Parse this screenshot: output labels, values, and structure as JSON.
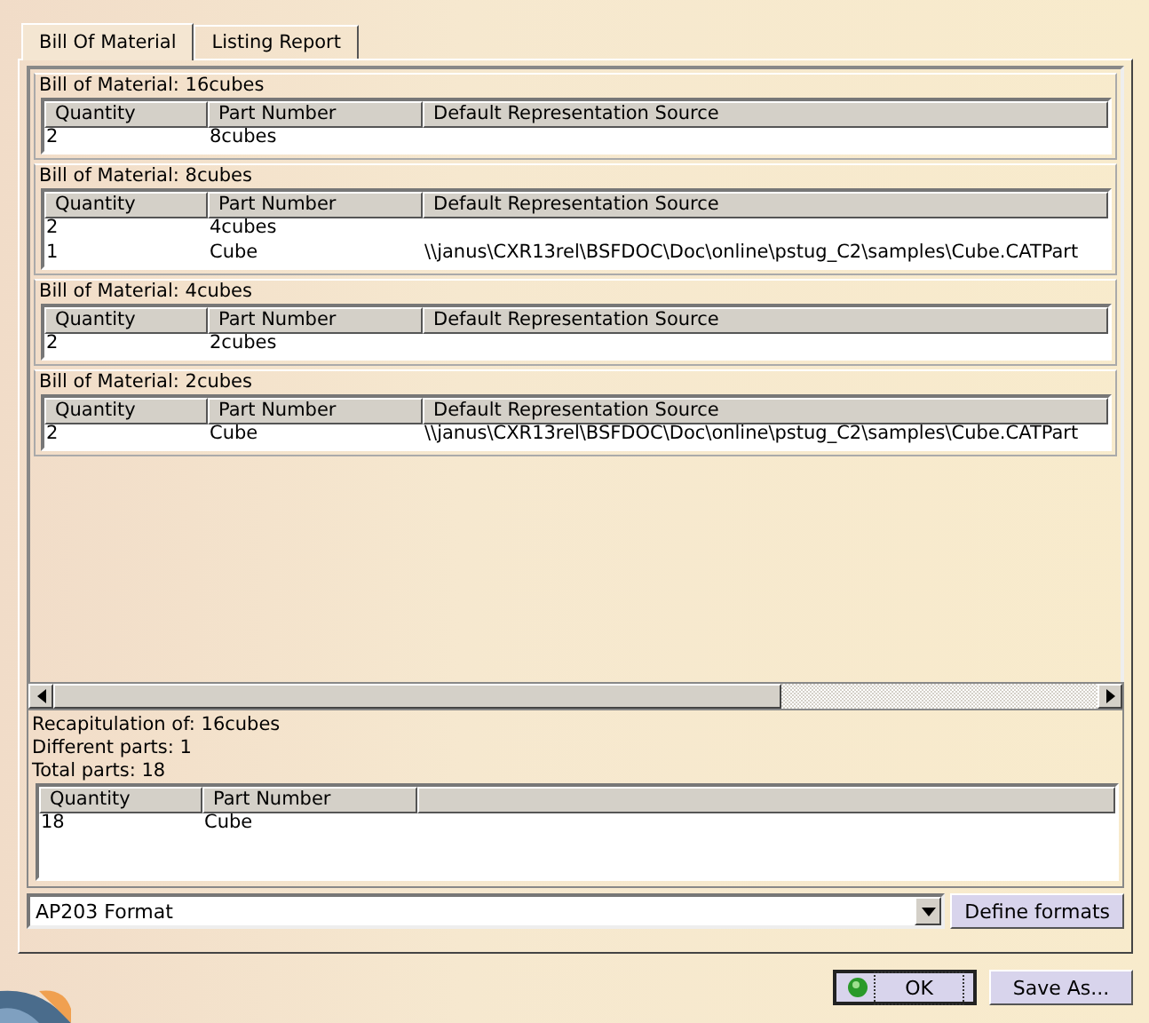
{
  "tabs": [
    {
      "label": "Bill Of Material",
      "selected": true
    },
    {
      "label": "Listing Report",
      "selected": false
    }
  ],
  "bom_sections": [
    {
      "title": "Bill of Material: 16cubes",
      "columns": [
        "Quantity",
        "Part Number",
        "Default Representation Source"
      ],
      "rows": [
        {
          "quantity": "2",
          "part_number": "8cubes"
        }
      ]
    },
    {
      "title": "Bill of Material: 8cubes",
      "columns": [
        "Quantity",
        "Part Number",
        "Default Representation Source"
      ],
      "rows": [
        {
          "quantity": "2",
          "part_number": "4cubes"
        },
        {
          "quantity": "1",
          "part_number": "Cube",
          "source": "\\\\janus\\CXR13rel\\BSFDOC\\Doc\\online\\pstug_C2\\samples\\Cube.CATPart"
        }
      ]
    },
    {
      "title": "Bill of Material: 4cubes",
      "columns": [
        "Quantity",
        "Part Number",
        "Default Representation Source"
      ],
      "rows": [
        {
          "quantity": "2",
          "part_number": "2cubes"
        }
      ]
    },
    {
      "title": "Bill of Material: 2cubes",
      "columns": [
        "Quantity",
        "Part Number",
        "Default Representation Source"
      ],
      "rows": [
        {
          "quantity": "2",
          "part_number": "Cube",
          "source": "\\\\janus\\CXR13rel\\BSFDOC\\Doc\\online\\pstug_C2\\samples\\Cube.CATPart"
        }
      ]
    }
  ],
  "recap": {
    "lines": [
      "Recapitulation of: 16cubes",
      "Different parts: 1",
      "Total parts: 18"
    ],
    "columns": [
      "Quantity",
      "Part Number"
    ],
    "rows": [
      {
        "quantity": "18",
        "part_number": "Cube"
      }
    ]
  },
  "format_select": {
    "value": "AP203 Format"
  },
  "define_formats_button": "Define formats",
  "buttons": [
    {
      "label": "OK",
      "kind": "default"
    },
    {
      "label": "Save As...",
      "kind": "plain"
    }
  ]
}
